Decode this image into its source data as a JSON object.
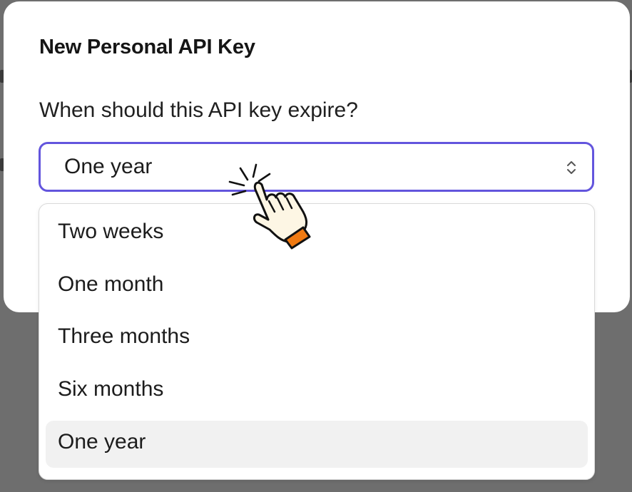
{
  "dialog": {
    "title": "New Personal API Key",
    "expiry_label": "When should this API key expire?",
    "selected_value": "One year"
  },
  "dropdown": {
    "options": [
      "Two weeks",
      "One month",
      "Three months",
      "Six months",
      "One year"
    ],
    "selected_index": 4
  },
  "icons": {
    "select_chevron": "chevron-up-down-icon",
    "pointer": "hand-pointer-click-icon"
  },
  "colors": {
    "focus_border": "#6355dd",
    "overlay": "#6e6e6e",
    "selected_option_bg": "#f1f1f1",
    "cursor_cuff": "#f07a12"
  }
}
